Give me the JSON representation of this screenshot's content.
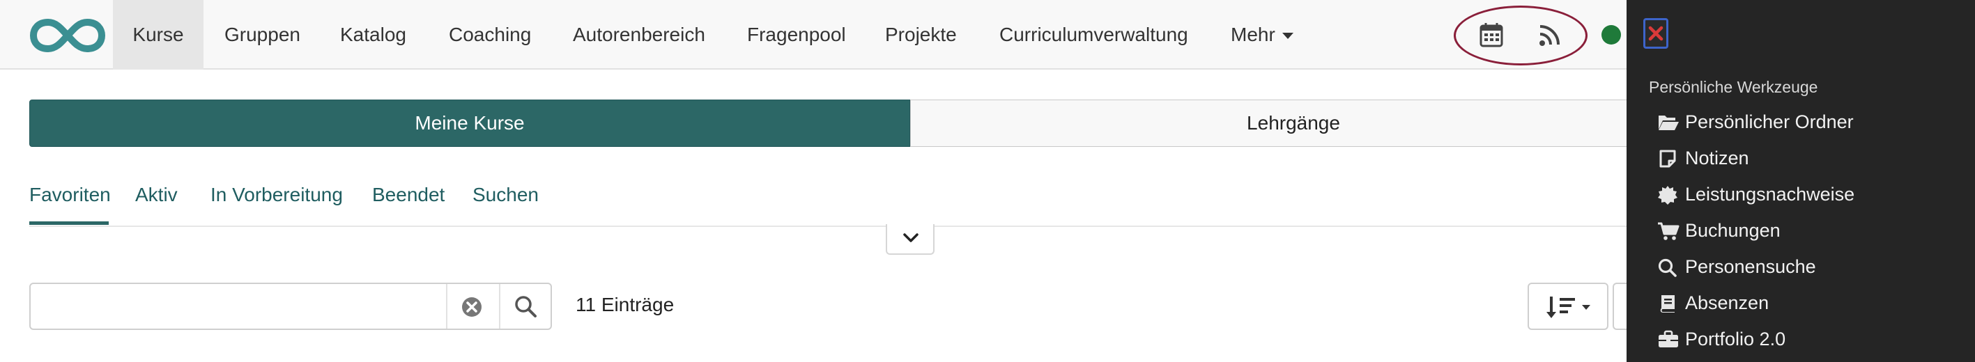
{
  "colors": {
    "brand": "#2c6766",
    "logo": "#3b8f92",
    "status_online": "#1f7a3a",
    "highlight_ring": "#8a1f3a",
    "panel_bg": "#252525",
    "close_accent": "#d93a3a"
  },
  "topnav": {
    "logo_icon": "infinity-logo-icon",
    "items": [
      {
        "label": "Kurse"
      },
      {
        "label": "Gruppen"
      },
      {
        "label": "Katalog"
      },
      {
        "label": "Coaching"
      },
      {
        "label": "Autorenbereich"
      },
      {
        "label": "Fragenpool"
      },
      {
        "label": "Projekte"
      },
      {
        "label": "Curriculumverwaltung"
      },
      {
        "label": "Mehr"
      }
    ],
    "active_item": "Kurse",
    "icons": [
      "calendar-icon",
      "rss-icon"
    ],
    "status": "online"
  },
  "switch": {
    "left": "Meine Kurse",
    "right": "Lehrgänge"
  },
  "tabs": [
    {
      "label": "Favoriten"
    },
    {
      "label": "Aktiv"
    },
    {
      "label": "In Vorbereitung"
    },
    {
      "label": "Beendet"
    },
    {
      "label": "Suchen"
    }
  ],
  "active_tab": "Favoriten",
  "search": {
    "value": "",
    "placeholder": ""
  },
  "results": {
    "count_label": "11 Einträge"
  },
  "panel": {
    "heading": "Persönliche Werkzeuge",
    "items": [
      {
        "label": "Persönlicher Ordner",
        "icon": "folder-open-icon"
      },
      {
        "label": "Notizen",
        "icon": "note-icon"
      },
      {
        "label": "Leistungsnachweise",
        "icon": "certificate-icon"
      },
      {
        "label": "Buchungen",
        "icon": "cart-icon"
      },
      {
        "label": "Personensuche",
        "icon": "search-icon"
      },
      {
        "label": "Absenzen",
        "icon": "book-icon"
      },
      {
        "label": "Portfolio 2.0",
        "icon": "briefcase-icon"
      }
    ]
  }
}
